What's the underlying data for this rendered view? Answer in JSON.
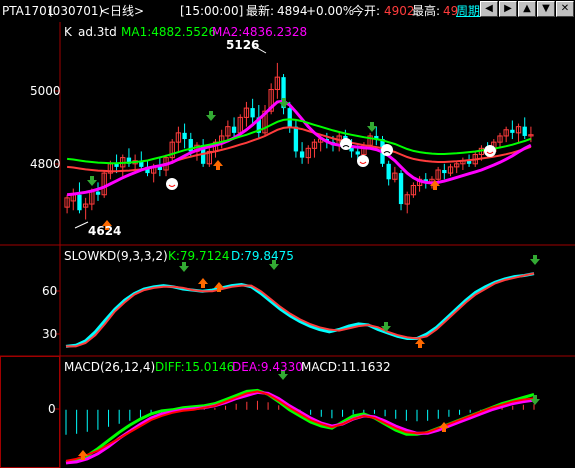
{
  "header": {
    "symbol": "PTA1701",
    "code": "(030701)",
    "period": "<日线>",
    "time": "[15:00:00]",
    "latest_label": "最新:",
    "latest_value": "4894",
    "change": "+0.00%",
    "open_label": "今开:",
    "open_value": "4902",
    "high_label": "最高:",
    "high_value": "49",
    "period_button": "周期",
    "nav_icons": [
      "arrow-left-icon",
      "arrow-right-icon",
      "arrow-up-icon",
      "arrow-down-icon",
      "close-icon"
    ]
  },
  "colors": {
    "up": "#ff3c3c",
    "down": "#00ffff",
    "ma1": "#00ff00",
    "ma2": "#ff00ff",
    "slowk": "#00ffff",
    "slowd": "#ff3c3c",
    "diff": "#00ff00",
    "dea": "#ff00ff",
    "macd_line": "#ff0000",
    "separator": "#a00000"
  },
  "main_panel": {
    "title": "K",
    "subtitle": "ad.3td",
    "ma1_label": "MA1:4882.5526",
    "ma2_label": "MA2:4836.2328",
    "y_ticks": [
      "5000",
      "4800"
    ],
    "high_marker": "5126",
    "low_marker": "4624"
  },
  "kd_panel": {
    "title": "SLOWKD(9,3,3,2)",
    "k_label": "K:79.7124",
    "d_label": "D:79.8475",
    "y_ticks": [
      "60",
      "30"
    ]
  },
  "macd_panel": {
    "title": "MACD(26,12,4)",
    "diff_label": "DIFF:15.0146",
    "dea_label": "DEA:9.4330",
    "macd_label": "MACD:11.1632",
    "y_ticks": [
      "0"
    ]
  },
  "chart_data": [
    {
      "type": "candlestick",
      "title": "K ad.3td",
      "ylim": [
        4570,
        5200
      ],
      "y_ticks": [
        5000,
        4800
      ],
      "ohlc": [
        [
          4660,
          4700,
          4640,
          4690
        ],
        [
          4680,
          4720,
          4650,
          4700
        ],
        [
          4700,
          4740,
          4640,
          4650
        ],
        [
          4660,
          4690,
          4620,
          4670
        ],
        [
          4670,
          4720,
          4650,
          4710
        ],
        [
          4710,
          4740,
          4680,
          4700
        ],
        [
          4700,
          4780,
          4690,
          4770
        ],
        [
          4770,
          4810,
          4750,
          4800
        ],
        [
          4800,
          4830,
          4770,
          4790
        ],
        [
          4790,
          4830,
          4760,
          4820
        ],
        [
          4820,
          4850,
          4790,
          4800
        ],
        [
          4800,
          4830,
          4770,
          4810
        ],
        [
          4810,
          4840,
          4780,
          4790
        ],
        [
          4790,
          4810,
          4760,
          4770
        ],
        [
          4770,
          4800,
          4740,
          4790
        ],
        [
          4790,
          4820,
          4760,
          4780
        ],
        [
          4780,
          4830,
          4760,
          4820
        ],
        [
          4820,
          4880,
          4800,
          4870
        ],
        [
          4870,
          4920,
          4840,
          4900
        ],
        [
          4900,
          4930,
          4850,
          4880
        ],
        [
          4880,
          4900,
          4820,
          4840
        ],
        [
          4840,
          4870,
          4810,
          4860
        ],
        [
          4860,
          4880,
          4790,
          4800
        ],
        [
          4800,
          4850,
          4790,
          4840
        ],
        [
          4840,
          4880,
          4820,
          4870
        ],
        [
          4870,
          4910,
          4850,
          4890
        ],
        [
          4890,
          4940,
          4870,
          4920
        ],
        [
          4920,
          4950,
          4880,
          4900
        ],
        [
          4900,
          4960,
          4890,
          4950
        ],
        [
          4950,
          5000,
          4920,
          4980
        ],
        [
          4980,
          5010,
          4930,
          4950
        ],
        [
          4950,
          4990,
          4880,
          4900
        ],
        [
          4900,
          4990,
          4890,
          4970
        ],
        [
          4970,
          5060,
          4960,
          5040
        ],
        [
          5040,
          5126,
          5010,
          5080
        ],
        [
          5080,
          5090,
          4960,
          4980
        ],
        [
          4980,
          5000,
          4900,
          4920
        ],
        [
          4920,
          4940,
          4820,
          4840
        ],
        [
          4840,
          4870,
          4800,
          4820
        ],
        [
          4820,
          4860,
          4800,
          4850
        ],
        [
          4850,
          4880,
          4820,
          4870
        ],
        [
          4870,
          4890,
          4840,
          4880
        ],
        [
          4880,
          4900,
          4850,
          4870
        ],
        [
          4870,
          4890,
          4840,
          4860
        ],
        [
          4860,
          4900,
          4840,
          4890
        ],
        [
          4890,
          4910,
          4850,
          4860
        ],
        [
          4860,
          4880,
          4820,
          4840
        ],
        [
          4840,
          4860,
          4810,
          4830
        ],
        [
          4830,
          4870,
          4820,
          4860
        ],
        [
          4860,
          4900,
          4850,
          4890
        ],
        [
          4890,
          4920,
          4860,
          4880
        ],
        [
          4880,
          4890,
          4790,
          4800
        ],
        [
          4800,
          4810,
          4730,
          4750
        ],
        [
          4750,
          4790,
          4740,
          4770
        ],
        [
          4770,
          4780,
          4650,
          4670
        ],
        [
          4670,
          4710,
          4640,
          4700
        ],
        [
          4700,
          4740,
          4690,
          4730
        ],
        [
          4730,
          4760,
          4710,
          4750
        ],
        [
          4750,
          4770,
          4720,
          4740
        ],
        [
          4740,
          4760,
          4720,
          4750
        ],
        [
          4750,
          4790,
          4740,
          4780
        ],
        [
          4780,
          4800,
          4750,
          4770
        ],
        [
          4770,
          4800,
          4760,
          4790
        ],
        [
          4790,
          4810,
          4770,
          4800
        ],
        [
          4800,
          4820,
          4780,
          4810
        ],
        [
          4810,
          4830,
          4790,
          4800
        ],
        [
          4800,
          4840,
          4790,
          4830
        ],
        [
          4830,
          4860,
          4810,
          4850
        ],
        [
          4850,
          4870,
          4820,
          4840
        ],
        [
          4840,
          4880,
          4830,
          4870
        ],
        [
          4870,
          4900,
          4850,
          4890
        ],
        [
          4890,
          4920,
          4870,
          4910
        ],
        [
          4910,
          4940,
          4880,
          4900
        ],
        [
          4900,
          4930,
          4870,
          4920
        ],
        [
          4920,
          4950,
          4880,
          4890
        ],
        [
          4890,
          4920,
          4870,
          4894
        ]
      ],
      "ma1": [
        4790,
        4788,
        4785,
        4782,
        4780,
        4778,
        4777,
        4776,
        4776,
        4777,
        4778,
        4780,
        4782,
        4785,
        4790,
        4795,
        4800,
        4806,
        4812,
        4818,
        4823,
        4828,
        4832,
        4836,
        4840,
        4845,
        4850,
        4856,
        4862,
        4868,
        4875,
        4882,
        4890,
        4900,
        4910,
        4916,
        4918,
        4916,
        4912,
        4906,
        4900,
        4894,
        4888,
        4882,
        4877,
        4872,
        4868,
        4864,
        4860,
        4857,
        4854,
        4850,
        4844,
        4838,
        4830,
        4822,
        4816,
        4812,
        4809,
        4807,
        4806,
        4806,
        4807,
        4808,
        4810,
        4812,
        4814,
        4817,
        4820,
        4823,
        4827,
        4831,
        4836,
        4842,
        4848,
        4855
      ],
      "ma2": [
        4700,
        4702,
        4705,
        4708,
        4712,
        4718,
        4725,
        4735,
        4745,
        4755,
        4764,
        4772,
        4780,
        4786,
        4790,
        4794,
        4798,
        4805,
        4815,
        4826,
        4836,
        4844,
        4850,
        4855,
        4860,
        4866,
        4874,
        4884,
        4896,
        4910,
        4926,
        4944,
        4962,
        4982,
        5000,
        5002,
        4990,
        4968,
        4944,
        4920,
        4900,
        4884,
        4872,
        4864,
        4860,
        4858,
        4856,
        4854,
        4852,
        4850,
        4846,
        4838,
        4826,
        4810,
        4790,
        4770,
        4755,
        4745,
        4740,
        4738,
        4740,
        4744,
        4750,
        4756,
        4762,
        4768,
        4774,
        4780,
        4788,
        4796,
        4805,
        4815,
        4826,
        4838,
        4850,
        4860
      ],
      "ma1_label": "MA1:4882.5526",
      "ma2_label": "MA2:4836.2328"
    },
    {
      "type": "line",
      "title": "SLOWKD(9,3,3,2)",
      "ylim": [
        10,
        90
      ],
      "y_ticks": [
        60,
        30
      ],
      "series": [
        {
          "name": "K",
          "values": [
            15,
            16,
            20,
            28,
            38,
            48,
            56,
            62,
            66,
            68,
            69,
            68,
            66,
            65,
            64,
            65,
            67,
            69,
            70,
            68,
            62,
            55,
            48,
            42,
            37,
            33,
            30,
            28,
            30,
            33,
            35,
            34,
            30,
            27,
            24,
            22,
            22,
            26,
            32,
            40,
            48,
            56,
            63,
            68,
            72,
            75,
            77,
            78,
            79.7124
          ]
        },
        {
          "name": "D",
          "values": [
            15,
            15,
            18,
            25,
            35,
            46,
            54,
            61,
            65,
            67,
            68,
            68,
            67,
            65,
            64,
            64,
            66,
            68,
            69,
            69,
            64,
            57,
            50,
            44,
            39,
            35,
            32,
            30,
            29,
            31,
            33,
            34,
            32,
            28,
            25,
            23,
            22,
            24,
            30,
            38,
            46,
            54,
            61,
            66,
            71,
            74,
            76,
            78,
            79.8475
          ]
        }
      ]
    },
    {
      "type": "line",
      "title": "MACD(26,12,4)",
      "ylim": [
        -55,
        35
      ],
      "y_ticks": [
        0
      ],
      "series": [
        {
          "name": "DIFF",
          "values": [
            -52,
            -50,
            -45,
            -38,
            -30,
            -22,
            -15,
            -9,
            -4,
            -1,
            0,
            2,
            3,
            4,
            6,
            10,
            14,
            18,
            19,
            15,
            8,
            0,
            -6,
            -12,
            -16,
            -18,
            -12,
            -6,
            -4,
            -8,
            -14,
            -20,
            -24,
            -24,
            -22,
            -18,
            -14,
            -10,
            -6,
            -2,
            2,
            6,
            9,
            12,
            15.0146
          ]
        },
        {
          "name": "DEA",
          "values": [
            -52,
            -51,
            -48,
            -43,
            -36,
            -28,
            -21,
            -14,
            -8,
            -4,
            -2,
            0,
            1,
            2,
            4,
            7,
            11,
            14,
            17,
            16,
            11,
            4,
            -2,
            -8,
            -13,
            -16,
            -14,
            -9,
            -6,
            -7,
            -11,
            -16,
            -20,
            -23,
            -23,
            -20,
            -16,
            -12,
            -8,
            -4,
            0,
            3,
            6,
            8,
            9.433
          ]
        },
        {
          "name": "MACD",
          "values": [
            -50,
            -48,
            -44,
            -40,
            -34,
            -28,
            -22,
            -16,
            -10,
            -6,
            -3,
            -1,
            0,
            2,
            4,
            8,
            12,
            16,
            18,
            15,
            9,
            2,
            -4,
            -10,
            -14,
            -17,
            -14,
            -9,
            -6,
            -8,
            -13,
            -18,
            -22,
            -23,
            -22,
            -18,
            -14,
            -10,
            -6,
            -2,
            2,
            5,
            8,
            10,
            11.1632
          ]
        }
      ]
    }
  ]
}
